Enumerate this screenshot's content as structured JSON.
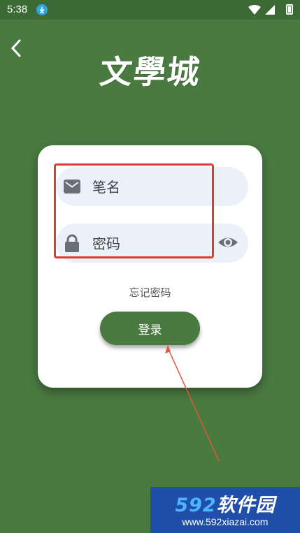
{
  "status_bar": {
    "time": "5:38",
    "icons": [
      "download-icon",
      "wifi-icon",
      "signal-icon",
      "battery-icon"
    ]
  },
  "header": {
    "back_icon": "chevron-left-icon",
    "logo_text": "文學城"
  },
  "login_form": {
    "username": {
      "icon": "mail-icon",
      "placeholder": "笔名",
      "value": ""
    },
    "password": {
      "icon": "lock-icon",
      "placeholder": "密码",
      "value": "",
      "toggle_icon": "eye-icon"
    },
    "forgot_password": "忘记密码",
    "submit_label": "登录"
  },
  "watermark": {
    "brand_number": "592",
    "brand_text": "软件园",
    "url": "www.592xiazai.com"
  },
  "colors": {
    "background": "#497a40",
    "button": "#497a40",
    "field": "#eaf1fa",
    "highlight": "#e23a2a",
    "watermark_bg": "#1f4fa8"
  }
}
